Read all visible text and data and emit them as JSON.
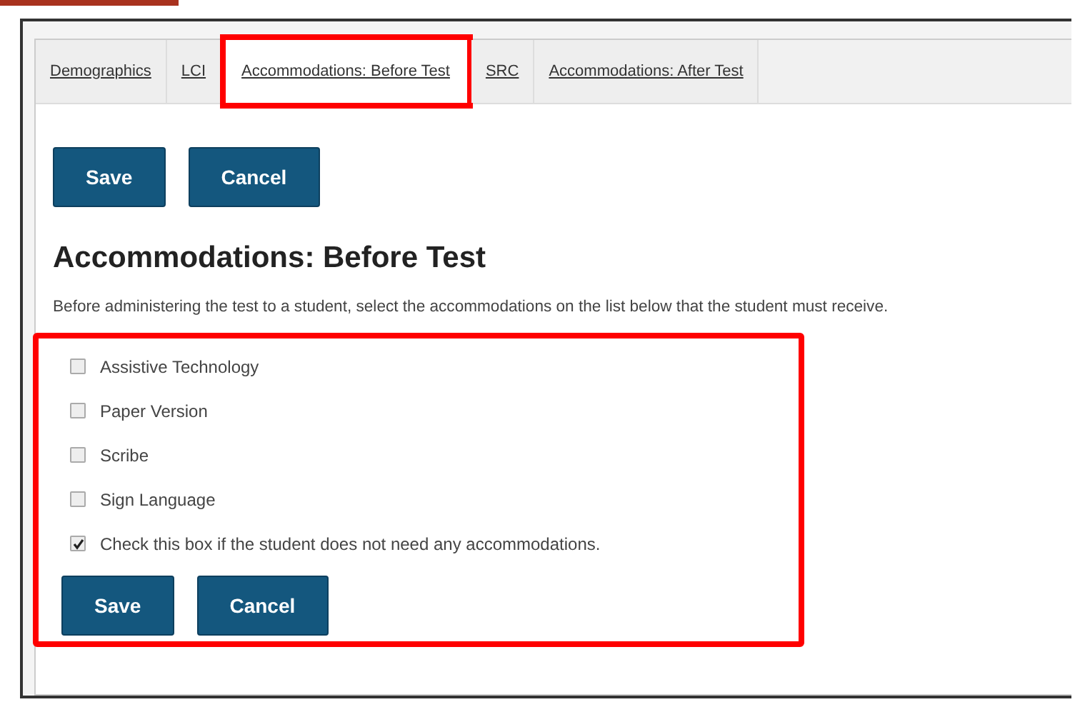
{
  "tabs": [
    {
      "label": "Demographics",
      "selected": false
    },
    {
      "label": "LCI",
      "selected": false
    },
    {
      "label": "Accommodations: Before Test",
      "selected": true,
      "highlighted": true
    },
    {
      "label": "SRC",
      "selected": false
    },
    {
      "label": "Accommodations: After Test",
      "selected": false
    }
  ],
  "top_buttons": [
    "Save",
    "Cancel"
  ],
  "heading": "Accommodations: Before Test",
  "description": "Before administering the test to a student, select the accommodations on the list below that the student must receive.",
  "accommodations": [
    {
      "label": "Assistive Technology",
      "checked": false
    },
    {
      "label": "Paper Version",
      "checked": false
    },
    {
      "label": "Scribe",
      "checked": false
    },
    {
      "label": "Sign Language",
      "checked": false
    },
    {
      "label": "Check this box if the student does not need any accommodations.",
      "checked": true
    }
  ],
  "bottom_buttons": [
    "Save",
    "Cancel"
  ]
}
